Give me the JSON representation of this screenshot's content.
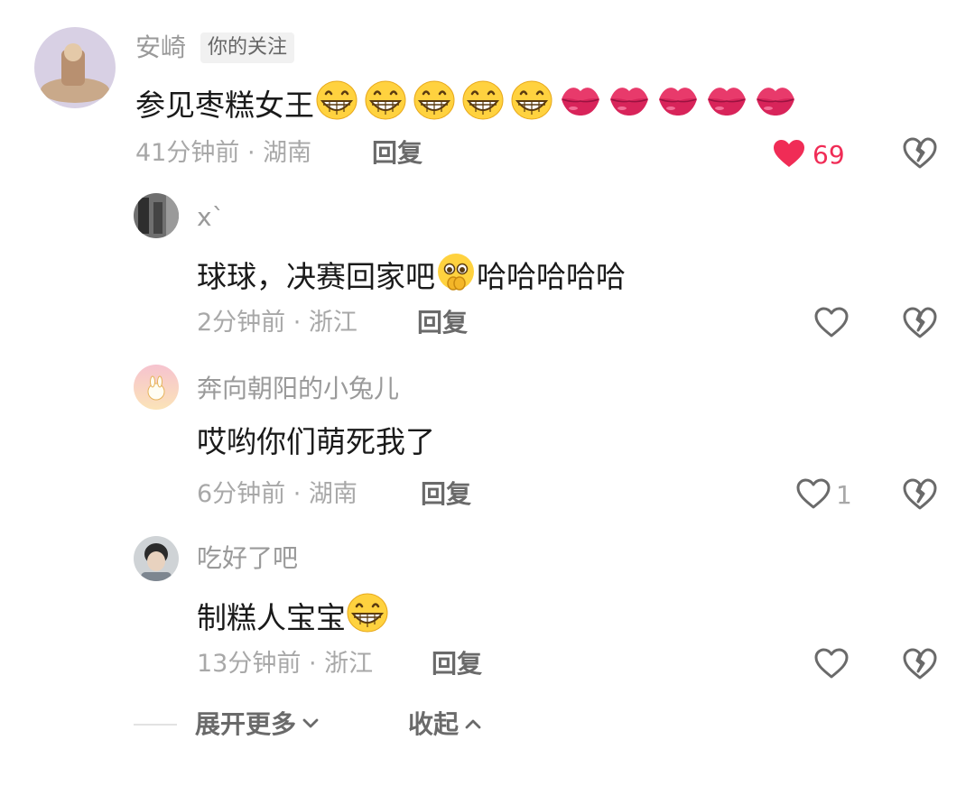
{
  "comments": [
    {
      "username": "安崎",
      "badge": "你的关注",
      "text": "参见枣糕女王",
      "time_location": "41分钟前 · 湖南",
      "reply_label": "回复",
      "like_count": "69",
      "liked": true,
      "emojis": [
        "grin-emoji",
        "grin-emoji",
        "grin-emoji",
        "grin-emoji",
        "grin-emoji",
        "kiss-lips-emoji",
        "kiss-lips-emoji",
        "kiss-lips-emoji",
        "kiss-lips-emoji",
        "kiss-lips-emoji"
      ]
    },
    {
      "username": "x`",
      "text_before": "球球，决赛回家吧",
      "text_after": "哈哈哈哈哈",
      "time_location": "2分钟前 · 浙江",
      "reply_label": "回复",
      "emojis": [
        "pleading-emoji"
      ]
    },
    {
      "username": "奔向朝阳的小兔儿",
      "text": "哎哟你们萌死我了",
      "time_location": "6分钟前 · 湖南",
      "reply_label": "回复",
      "like_count": "1"
    },
    {
      "username": "吃好了吧",
      "text": "制糕人宝宝",
      "time_location": "13分钟前 · 浙江",
      "reply_label": "回复",
      "emojis": [
        "grin-emoji"
      ]
    }
  ],
  "footer": {
    "expand_label": "展开更多",
    "collapse_label": "收起"
  },
  "colors": {
    "like_red": "#f02c56",
    "meta_gray": "#a8a8a8",
    "emoji_yellow": "#ffd23f",
    "lips_pink": "#e83a6b"
  }
}
